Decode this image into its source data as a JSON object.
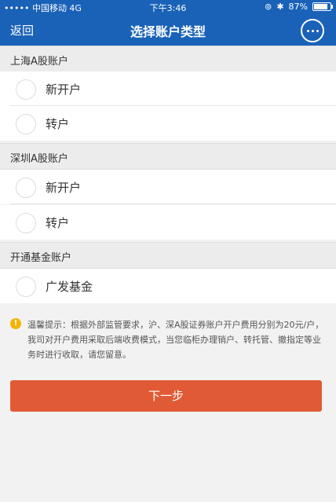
{
  "status_bar": {
    "carrier": "••••• 中国移动  4G",
    "time": "下午3:46",
    "battery": "87%"
  },
  "nav": {
    "back_label": "返回",
    "title": "选择账户类型",
    "chat_icon": "chat-bubble-icon"
  },
  "sections": [
    {
      "title": "上海A股账户",
      "options": [
        "新开户",
        "转户"
      ]
    },
    {
      "title": "深圳A股账户",
      "options": [
        "新开户",
        "转户"
      ]
    },
    {
      "title": "开通基金账户",
      "options": [
        "广发基金"
      ]
    }
  ],
  "tip": {
    "icon": "info-icon",
    "text": "温馨提示：根据外部监管要求，沪、深A股证券账户开户费用分别为20元/户，我司对开户费用采取后端收费模式，当您临柜办理销户、转托管、撤指定等业务时进行收取，请您留意。"
  },
  "next_button": "下一步",
  "colors": {
    "nav_bg": "#1a62b8",
    "button_bg": "#e05a36",
    "tip_icon": "#f5b400"
  }
}
